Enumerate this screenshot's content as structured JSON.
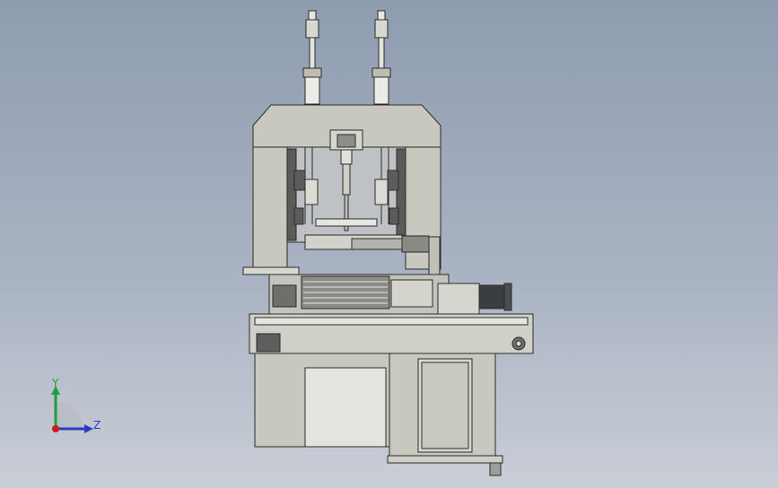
{
  "viewport": {
    "background_top": "#8f9cb0",
    "background_bottom": "#c9ced6"
  },
  "model": {
    "body_color": "#c8c8bf",
    "line_color": "#2b2b2b",
    "motor_color": "#3a3d42"
  },
  "triad": {
    "y_label": "Y",
    "z_label": "Z",
    "y_color": "#1f9d3a",
    "z_color": "#2a3fbf",
    "origin_color": "#d01818",
    "icons": [
      "coordinate-triad-icon"
    ]
  }
}
